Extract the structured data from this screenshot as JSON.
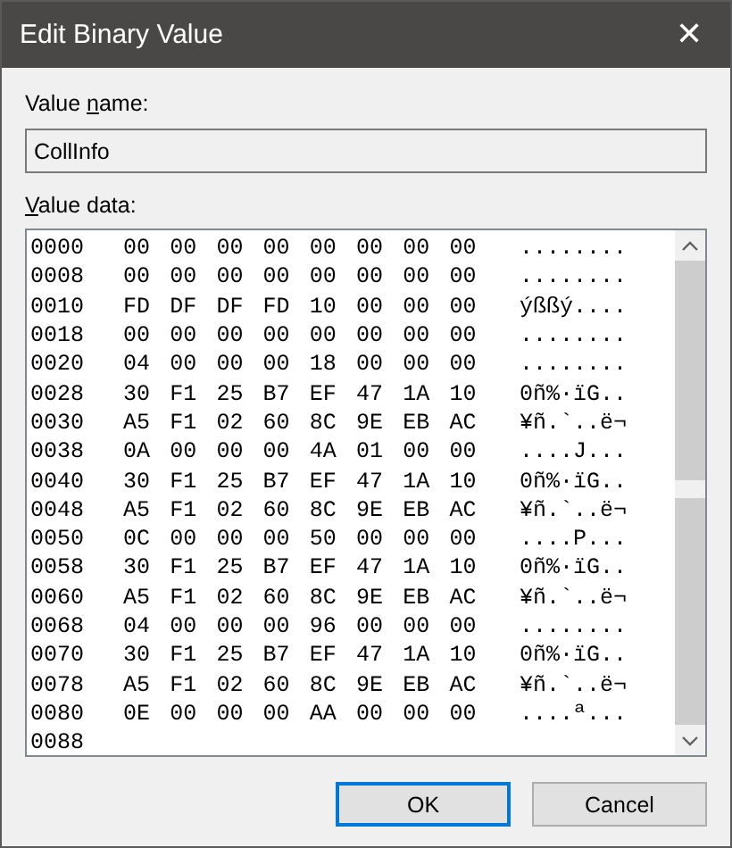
{
  "window": {
    "title": "Edit Binary Value",
    "close": "✕"
  },
  "value_name": {
    "label": {
      "before": "Value ",
      "key": "n",
      "after": "ame:"
    },
    "value": "CollInfo"
  },
  "value_data": {
    "label": {
      "key": "V",
      "after": "alue data:"
    },
    "rows": [
      {
        "address": "0000",
        "bytes": "00 00 00 00 00 00 00 00",
        "ascii": "........"
      },
      {
        "address": "0008",
        "bytes": "00 00 00 00 00 00 00 00",
        "ascii": "........"
      },
      {
        "address": "0010",
        "bytes": "FD DF DF FD 10 00 00 00",
        "ascii": "ýßßý...."
      },
      {
        "address": "0018",
        "bytes": "00 00 00 00 00 00 00 00",
        "ascii": "........"
      },
      {
        "address": "0020",
        "bytes": "04 00 00 00 18 00 00 00",
        "ascii": "........"
      },
      {
        "address": "0028",
        "bytes": "30 F1 25 B7 EF 47 1A 10",
        "ascii": "0ñ%·ïG.."
      },
      {
        "address": "0030",
        "bytes": "A5 F1 02 60 8C 9E EB AC",
        "ascii": "¥ñ.`..ë¬"
      },
      {
        "address": "0038",
        "bytes": "0A 00 00 00 4A 01 00 00",
        "ascii": "....J..."
      },
      {
        "address": "0040",
        "bytes": "30 F1 25 B7 EF 47 1A 10",
        "ascii": "0ñ%·ïG.."
      },
      {
        "address": "0048",
        "bytes": "A5 F1 02 60 8C 9E EB AC",
        "ascii": "¥ñ.`..ë¬"
      },
      {
        "address": "0050",
        "bytes": "0C 00 00 00 50 00 00 00",
        "ascii": "....P..."
      },
      {
        "address": "0058",
        "bytes": "30 F1 25 B7 EF 47 1A 10",
        "ascii": "0ñ%·ïG.."
      },
      {
        "address": "0060",
        "bytes": "A5 F1 02 60 8C 9E EB AC",
        "ascii": "¥ñ.`..ë¬"
      },
      {
        "address": "0068",
        "bytes": "04 00 00 00 96 00 00 00",
        "ascii": "........"
      },
      {
        "address": "0070",
        "bytes": "30 F1 25 B7 EF 47 1A 10",
        "ascii": "0ñ%·ïG.."
      },
      {
        "address": "0078",
        "bytes": "A5 F1 02 60 8C 9E EB AC",
        "ascii": "¥ñ.`..ë¬"
      },
      {
        "address": "0080",
        "bytes": "0E 00 00 00 AA 00 00 00",
        "ascii": "....ª..."
      },
      {
        "address": "0088"
      }
    ]
  },
  "buttons": [
    {
      "label": "OK",
      "default": true
    },
    {
      "label": "Cancel",
      "default": false
    }
  ]
}
